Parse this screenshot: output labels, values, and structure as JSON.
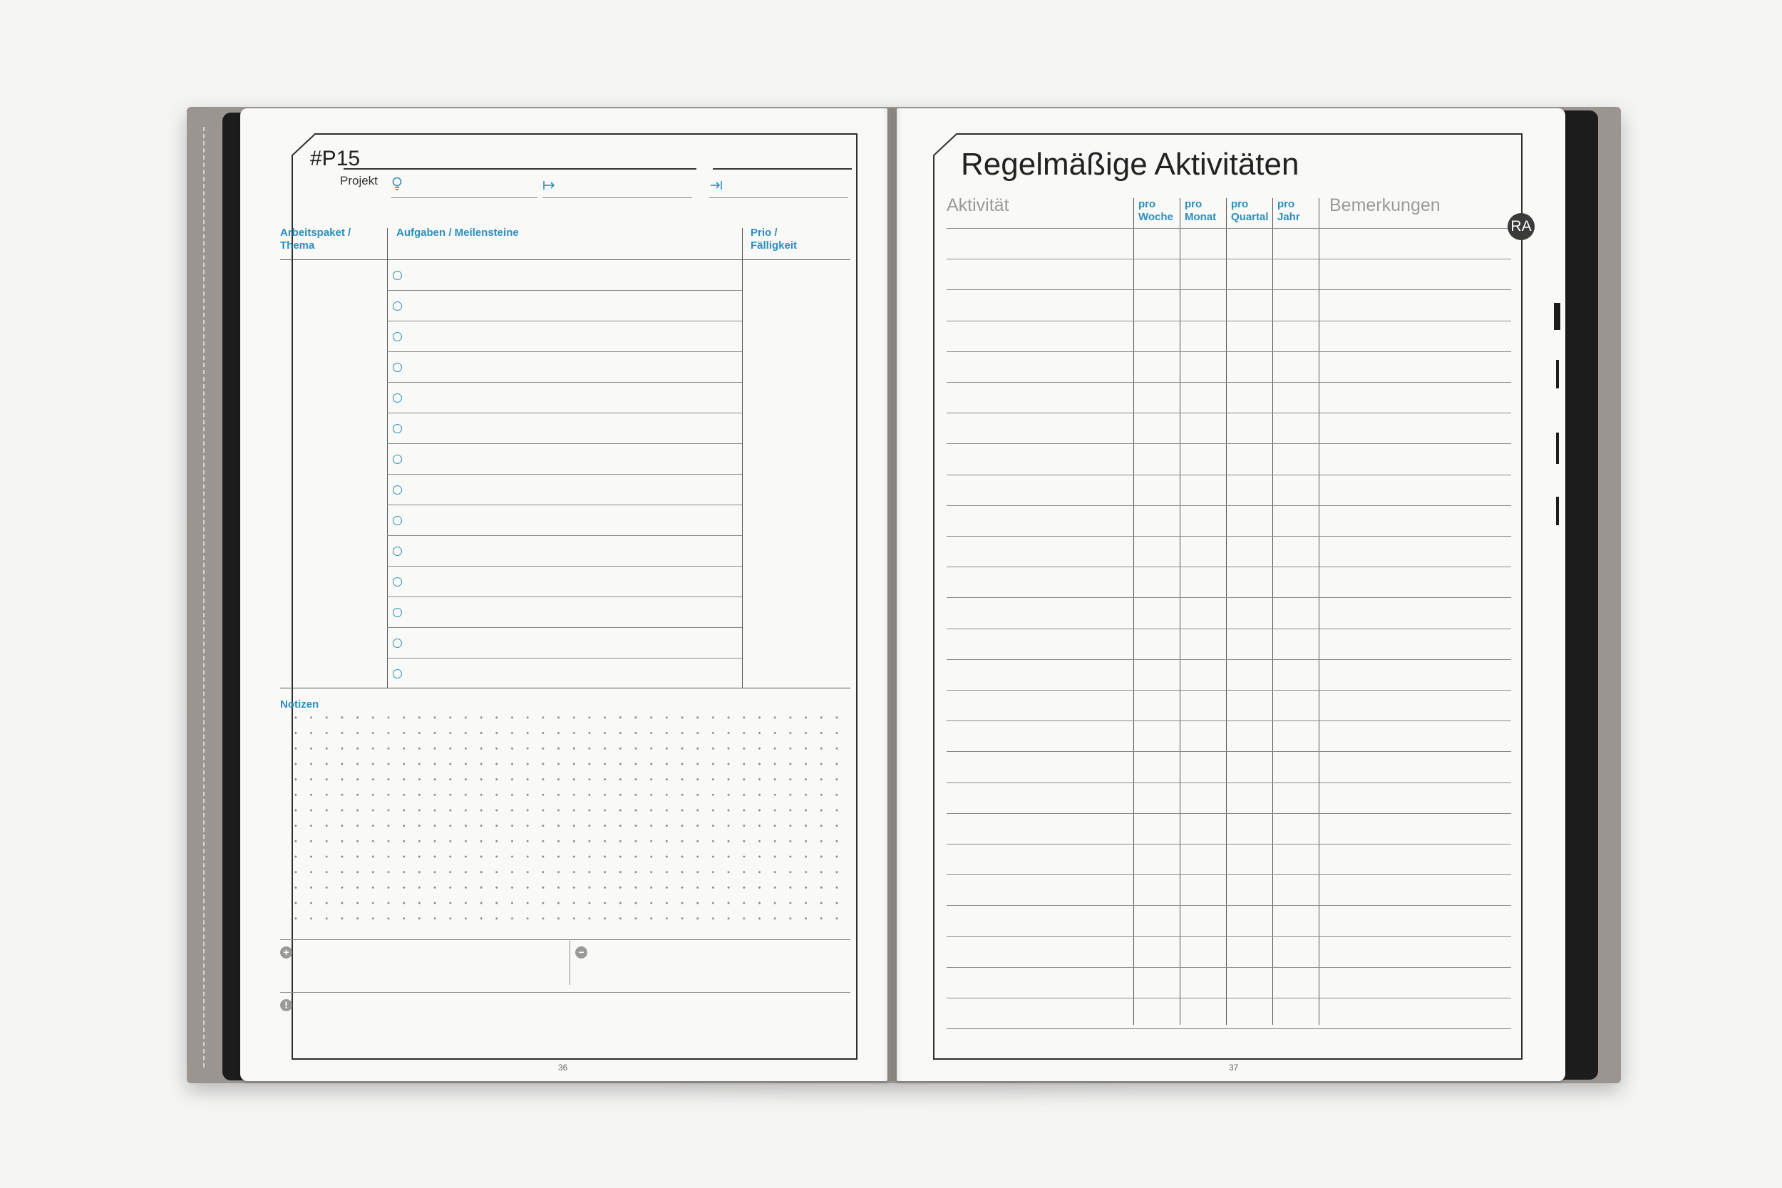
{
  "left_page": {
    "project_code": "#P15",
    "project_label": "Projekt",
    "icons": [
      "lightbulb-icon",
      "start-arrow-icon",
      "end-arrow-icon"
    ],
    "columns": {
      "work_package": "Arbeitspaket / Thema",
      "tasks": "Aufgaben / Meilensteine",
      "priority": "Prio / Fälligkeit"
    },
    "task_rows": 14,
    "notes_label": "Notizen",
    "pros_icon": "+",
    "cons_icon": "−",
    "alert_icon": "!",
    "page_number": "36"
  },
  "right_page": {
    "title": "Regelmäßige Aktivitäten",
    "columns": {
      "activity": "Aktivität",
      "per_week": "pro Woche",
      "per_month": "pro Monat",
      "per_quarter": "pro Quartal",
      "per_year": "pro Jahr",
      "remarks": "Bemerkungen"
    },
    "tab_badge": "RA",
    "page_number": "37"
  },
  "colors": {
    "accent_blue": "#2a8fc1",
    "cover_gray": "#9a9590",
    "paper": "#f9f9f7",
    "ink": "#2e2e2e"
  }
}
